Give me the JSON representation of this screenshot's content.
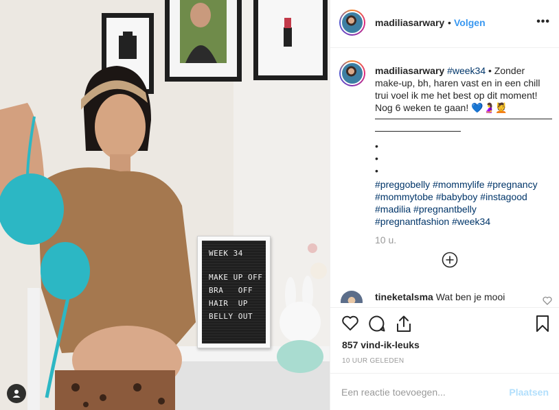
{
  "post": {
    "username": "madiliasarwary",
    "header_separator": "•",
    "follow_label": "Volgen",
    "more_label": "•••",
    "photo": {
      "letterboard": {
        "lines": [
          "WEEK 34",
          "MAKE UP OFF",
          "BRA   OFF",
          "HAIR  UP",
          "BELLY OUT"
        ]
      }
    },
    "caption": {
      "username": "madiliasarwary",
      "first_hashtag": "#week34",
      "text": " • Zonder make-up, bh, haren vast en in een chill trui voel ik me het best op dit moment! Nog 6 weken te gaan! 💙🤰💆",
      "bullets": [
        "•",
        "•",
        "•"
      ],
      "hashtags": "#preggobelly #mommylife #pregnancy #mommytobe #babyboy #instagood #madilia #pregnantbelly #pregnantfashion #week34"
    },
    "time_ago": "10 u.",
    "comment": {
      "username": "tineketalsma",
      "text": "Wat ben je mooi"
    },
    "likes": "857 vind-ik-leuks",
    "posted_at": "10 UUR GELEDEN",
    "add_comment": {
      "placeholder": "Een reactie toevoegen...",
      "post_label": "Plaatsen"
    },
    "icons": [
      "user-tag-icon",
      "more-icon",
      "plus-circle-icon",
      "heart-icon",
      "comment-icon",
      "share-icon",
      "bookmark-icon"
    ],
    "colors": {
      "link_blue": "#3897f0",
      "hashtag": "#003569",
      "muted": "#999999",
      "post_disabled": "#b2dffc"
    }
  }
}
